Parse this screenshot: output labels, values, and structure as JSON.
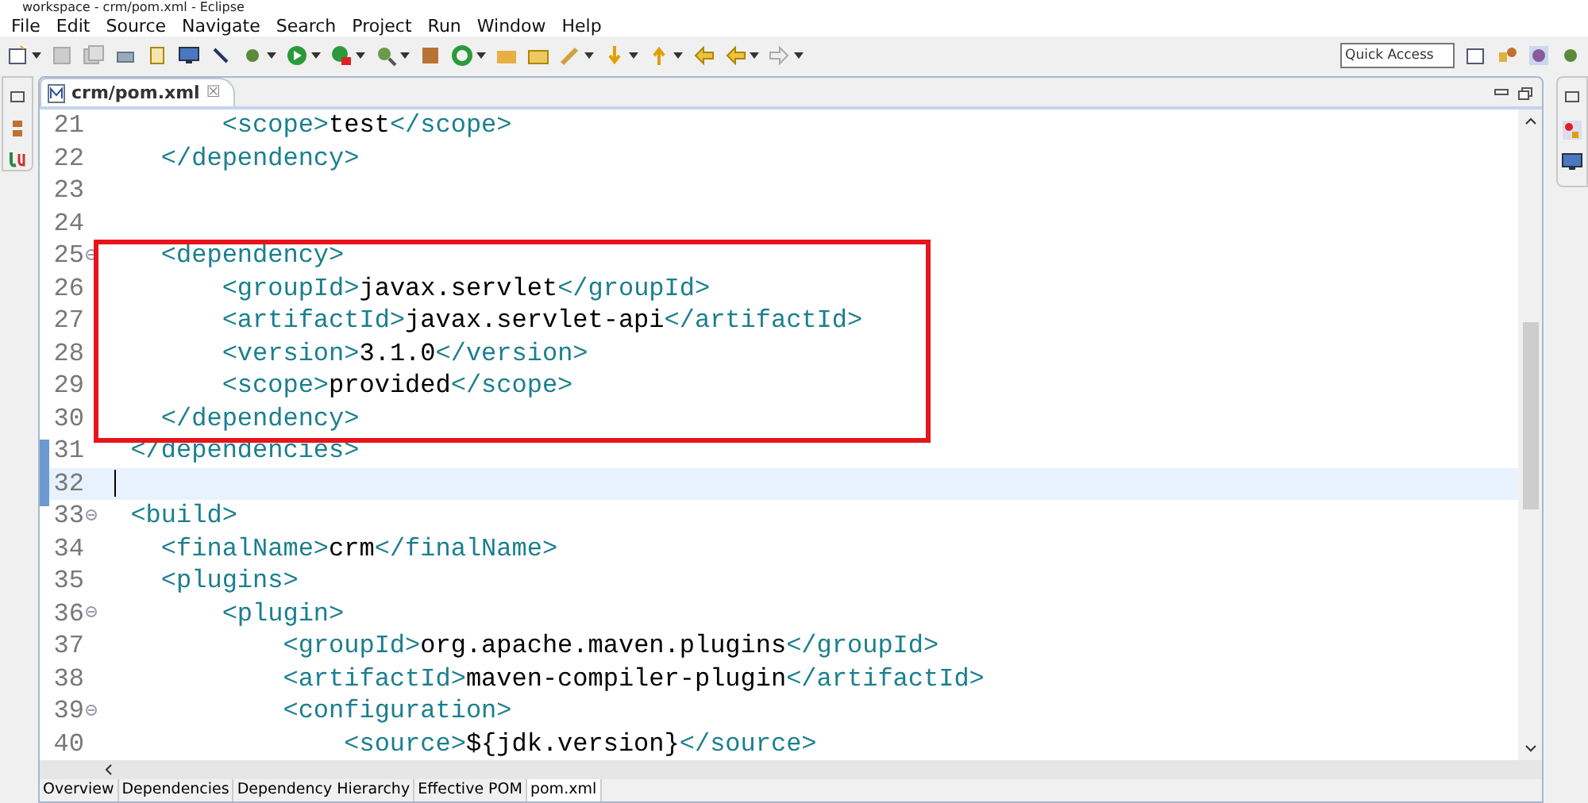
{
  "window": {
    "title": "workspace - crm/pom.xml - Eclipse"
  },
  "menu": [
    "File",
    "Edit",
    "Source",
    "Navigate",
    "Search",
    "Project",
    "Run",
    "Window",
    "Help"
  ],
  "quick_access": {
    "placeholder": "Quick Access"
  },
  "editor_tab": {
    "label": "crm/pom.xml",
    "close": "☒"
  },
  "lines": [
    {
      "number": "21",
      "text": "        <scope>test</scope>",
      "fold": false,
      "current": false,
      "boxed": false
    },
    {
      "number": "22",
      "text": "    </dependency>",
      "fold": false,
      "current": false,
      "boxed": false
    },
    {
      "number": "23",
      "fold": false,
      "current": false,
      "boxed": false
    },
    {
      "number": "24",
      "fold": false,
      "current": false,
      "boxed": false
    },
    {
      "number": "25",
      "text": "    <dependency>",
      "fold": true,
      "current": false,
      "boxed": true
    },
    {
      "number": "26",
      "text": "        <groupId>javax.servlet</groupId>",
      "fold": false,
      "current": false,
      "boxed": true
    },
    {
      "number": "27",
      "text": "        <artifactId>javax.servlet-api</artifactId>",
      "fold": false,
      "current": false,
      "boxed": true
    },
    {
      "number": "28",
      "text": "        <version>3.1.0</version>",
      "fold": false,
      "current": false,
      "boxed": true
    },
    {
      "number": "29",
      "text": "        <scope>provided</scope>",
      "fold": false,
      "current": false,
      "boxed": true
    },
    {
      "number": "30",
      "text": "    </dependency>",
      "fold": false,
      "current": false,
      "boxed": true
    },
    {
      "number": "31",
      "text": "  </dependencies>",
      "fold": false,
      "current": false,
      "boxed": false
    },
    {
      "number": "32",
      "fold": false,
      "current": true,
      "boxed": false
    },
    {
      "number": "33",
      "text": "  <build>",
      "fold": true,
      "current": false,
      "boxed": false
    },
    {
      "number": "34",
      "text": "    <finalName>crm</finalName>",
      "fold": false,
      "current": false,
      "boxed": false
    },
    {
      "number": "35",
      "text": "    <plugins>",
      "fold": false,
      "current": false,
      "boxed": false
    },
    {
      "number": "36",
      "text": "        <plugin>",
      "fold": true,
      "current": false,
      "boxed": false
    },
    {
      "number": "37",
      "text": "            <groupId>org.apache.maven.plugins</groupId>",
      "fold": false,
      "current": false,
      "boxed": false
    },
    {
      "number": "38",
      "text": "            <artifactId>maven-compiler-plugin</artifactId>",
      "fold": false,
      "current": false,
      "boxed": false
    },
    {
      "number": "39",
      "text": "            <configuration>",
      "fold": true,
      "current": false,
      "boxed": false
    },
    {
      "number": "40",
      "text": "                <source>${jdk.version}</source>",
      "fold": false,
      "current": false,
      "boxed": false
    }
  ],
  "bottom_tabs": [
    {
      "label": "Overview",
      "selected": false
    },
    {
      "label": "Dependencies",
      "selected": false
    },
    {
      "label": "Dependency Hierarchy",
      "selected": false
    },
    {
      "label": "Effective POM",
      "selected": false
    },
    {
      "label": "pom.xml",
      "selected": true
    }
  ]
}
